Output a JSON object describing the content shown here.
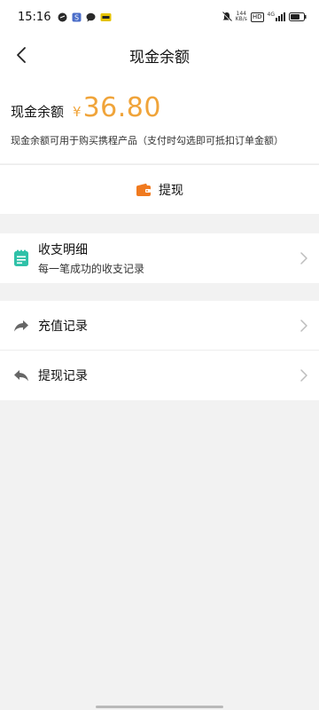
{
  "status_bar": {
    "time": "15:16",
    "left_icons": [
      "link-app-icon",
      "shield-app-icon",
      "chat-bubble-icon",
      "notification-badge-icon"
    ],
    "right_icons": [
      "mute-icon",
      "network-speed-icon",
      "hd-icon",
      "signal-icon",
      "battery-icon"
    ],
    "network_speed": "144",
    "network_speed_unit": "KB/s",
    "hd_label": "HD",
    "signal_label": "4G"
  },
  "navbar": {
    "title": "现金余额"
  },
  "balance": {
    "label": "现金余额",
    "currency_symbol": "¥",
    "amount": "36.80",
    "note": "现金余额可用于购买携程产品（支付时勾选即可抵扣订单金额）"
  },
  "withdraw": {
    "label": "提现"
  },
  "detail": {
    "title": "收支明细",
    "subtitle": "每一笔成功的收支记录"
  },
  "records": [
    {
      "label": "充值记录",
      "icon": "forward-arrow-icon"
    },
    {
      "label": "提现记录",
      "icon": "reply-arrow-icon"
    }
  ],
  "colors": {
    "accent": "#f0a43a",
    "wallet_icon": "#f07a1f",
    "detail_icon": "#2fc1a8",
    "background": "#f2f2f2"
  }
}
